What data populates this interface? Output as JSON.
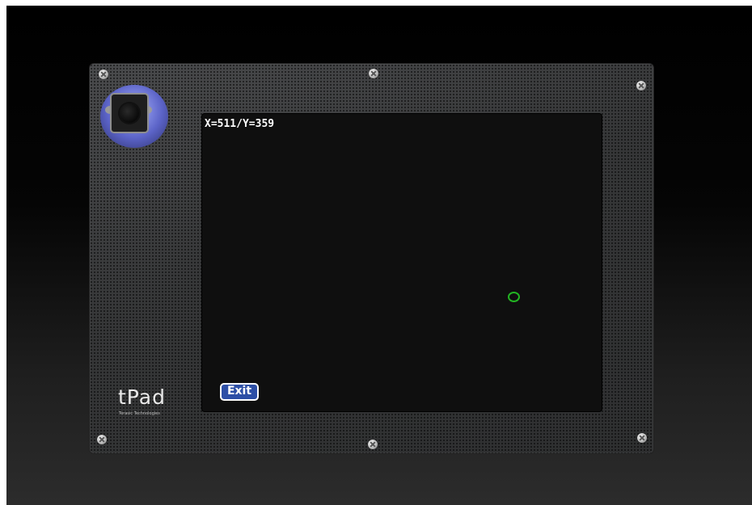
{
  "screen": {
    "coordinates_text": "X=511/Y=359",
    "exit_label": "Exit",
    "cursor_color": "#22b422"
  },
  "device": {
    "brand_name": "tPad",
    "brand_company": "Terasic Technologies",
    "camera_icon": "webcam-icon",
    "screw_icon": "screw-icon"
  },
  "colors": {
    "exit_button_bg": "#2d4fa6",
    "screen_bg": "#0f0f0f",
    "panel_bg": "#3a3b3c"
  }
}
